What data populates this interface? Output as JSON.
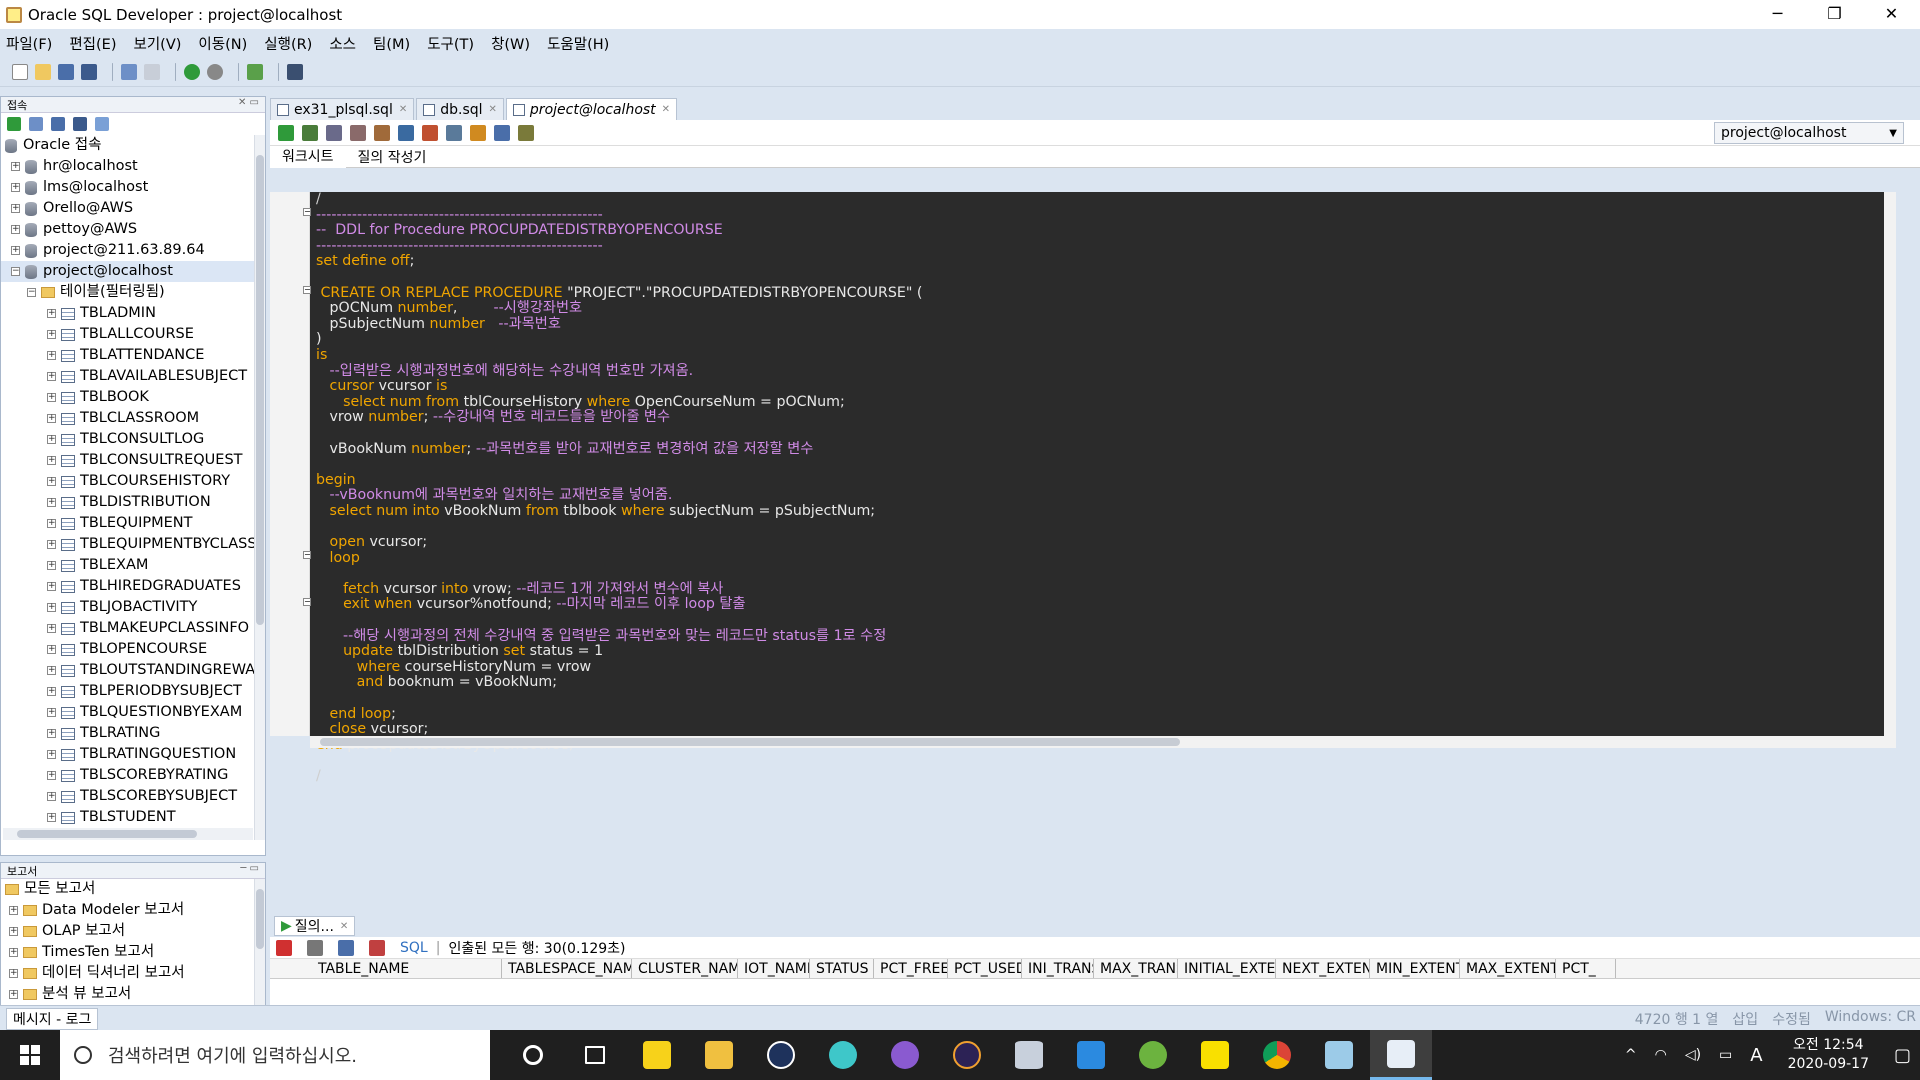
{
  "window": {
    "title": "Oracle SQL Developer : project@localhost",
    "min": "─",
    "max": "❐",
    "close": "✕"
  },
  "menu": [
    "파일(F)",
    "편집(E)",
    "보기(V)",
    "이동(N)",
    "실행(R)",
    "소스",
    "팀(M)",
    "도구(T)",
    "창(W)",
    "도움말(H)"
  ],
  "connections_panel": {
    "title": "접속",
    "root": "Oracle 접속",
    "items": [
      "hr@localhost",
      "lms@localhost",
      "Orello@AWS",
      "pettoy@AWS",
      "project@211.63.89.64",
      "project@localhost"
    ],
    "tables_folder": "테이블(필터링됨)",
    "tables": [
      "TBLADMIN",
      "TBLALLCOURSE",
      "TBLATTENDANCE",
      "TBLAVAILABLESUBJECT",
      "TBLBOOK",
      "TBLCLASSROOM",
      "TBLCONSULTLOG",
      "TBLCONSULTREQUEST",
      "TBLCOURSEHISTORY",
      "TBLDISTRIBUTION",
      "TBLEQUIPMENT",
      "TBLEQUIPMENTBYCLASS",
      "TBLEXAM",
      "TBLHIREDGRADUATES",
      "TBLJOBACTIVITY",
      "TBLMAKEUPCLASSINFO",
      "TBLOPENCOURSE",
      "TBLOUTSTANDINGREWA",
      "TBLPERIODBYSUBJECT",
      "TBLQUESTIONBYEXAM",
      "TBLRATING",
      "TBLRATINGQUESTION",
      "TBLSCOREBYRATING",
      "TBLSCOREBYSUBJECT",
      "TBLSTUDENT"
    ]
  },
  "reports_panel": {
    "title": "보고서",
    "items": [
      "모든 보고서",
      "Data Modeler 보고서",
      "OLAP 보고서",
      "TimesTen 보고서",
      "데이터 딕셔너리 보고서",
      "분석 뷰 보고서"
    ]
  },
  "editor": {
    "tabs": [
      {
        "label": "ex31_plsql.sql",
        "active": false
      },
      {
        "label": "db.sql",
        "active": false
      },
      {
        "label": "project@localhost",
        "active": true
      }
    ],
    "connection": "project@localhost",
    "subtabs": [
      "워크시트",
      "질의 작성기"
    ],
    "code_lines": [
      [
        [
          "dl",
          "/"
        ]
      ],
      [
        [
          "c",
          "--------------------------------------------------------"
        ]
      ],
      [
        [
          "c",
          "--  DDL for Procedure PROCUPDATEDISTRBYOPENCOURSE"
        ]
      ],
      [
        [
          "c",
          "--------------------------------------------------------"
        ]
      ],
      [
        [
          "k",
          "set define off"
        ],
        [
          "s",
          ";"
        ]
      ],
      [],
      [
        [
          "k",
          " CREATE OR REPLACE PROCEDURE "
        ],
        [
          "s",
          "\"PROJECT\".\"PROCUPDATEDISTRBYOPENCOURSE\" ("
        ]
      ],
      [
        [
          "s",
          "   pOCNum "
        ],
        [
          "k",
          "number"
        ],
        [
          "s",
          ",        "
        ],
        [
          "c",
          "--시행강좌번호"
        ]
      ],
      [
        [
          "s",
          "   pSubjectNum "
        ],
        [
          "k",
          "number"
        ],
        [
          "s",
          "   "
        ],
        [
          "c",
          "--과목번호"
        ]
      ],
      [
        [
          "s",
          ")"
        ]
      ],
      [
        [
          "k",
          "is"
        ]
      ],
      [
        [
          "c",
          "   --입력받은 시행과정번호에 해당하는 수강내역 번호만 가져옴."
        ]
      ],
      [
        [
          "s",
          "   "
        ],
        [
          "k",
          "cursor"
        ],
        [
          "s",
          " vcursor "
        ],
        [
          "k",
          "is"
        ]
      ],
      [
        [
          "s",
          "      "
        ],
        [
          "k",
          "select num from"
        ],
        [
          "s",
          " tblCourseHistory "
        ],
        [
          "k",
          "where"
        ],
        [
          "s",
          " OpenCourseNum = pOCNum;"
        ]
      ],
      [
        [
          "s",
          "   vrow "
        ],
        [
          "k",
          "number"
        ],
        [
          "s",
          "; "
        ],
        [
          "c",
          "--수강내역 번호 레코드들을 받아줄 변수"
        ]
      ],
      [],
      [
        [
          "s",
          "   vBookNum "
        ],
        [
          "k",
          "number"
        ],
        [
          "s",
          "; "
        ],
        [
          "c",
          "--과목번호를 받아 교재번호로 변경하여 값을 저장할 변수"
        ]
      ],
      [],
      [
        [
          "k",
          "begin"
        ]
      ],
      [
        [
          "c",
          "   --vBooknum에 과목번호와 일치하는 교재번호를 넣어줌."
        ]
      ],
      [
        [
          "s",
          "   "
        ],
        [
          "k",
          "select num into"
        ],
        [
          "s",
          " vBookNum "
        ],
        [
          "k",
          "from"
        ],
        [
          "s",
          " tblbook "
        ],
        [
          "k",
          "where"
        ],
        [
          "s",
          " subjectNum = pSubjectNum;"
        ]
      ],
      [],
      [
        [
          "s",
          "   "
        ],
        [
          "k",
          "open"
        ],
        [
          "s",
          " vcursor;"
        ]
      ],
      [
        [
          "s",
          "   "
        ],
        [
          "k",
          "loop"
        ]
      ],
      [],
      [
        [
          "s",
          "      "
        ],
        [
          "k",
          "fetch"
        ],
        [
          "s",
          " vcursor "
        ],
        [
          "k",
          "into"
        ],
        [
          "s",
          " vrow; "
        ],
        [
          "c",
          "--레코드 1개 가져와서 변수에 복사"
        ]
      ],
      [
        [
          "s",
          "      "
        ],
        [
          "k",
          "exit when"
        ],
        [
          "s",
          " vcursor%notfound; "
        ],
        [
          "c",
          "--마지막 레코드 이후 loop 탈출"
        ]
      ],
      [],
      [
        [
          "c",
          "      --해당 시행과정의 전체 수강내역 중 입력받은 과목번호와 맞는 레코드만 status를 1로 수정"
        ]
      ],
      [
        [
          "s",
          "      "
        ],
        [
          "k",
          "update"
        ],
        [
          "s",
          " tblDistribution "
        ],
        [
          "k",
          "set"
        ],
        [
          "s",
          " status = 1"
        ]
      ],
      [
        [
          "s",
          "         "
        ],
        [
          "k",
          "where"
        ],
        [
          "s",
          " courseHistoryNum = vrow"
        ]
      ],
      [
        [
          "s",
          "         "
        ],
        [
          "k",
          "and"
        ],
        [
          "s",
          " booknum = vBookNum;"
        ]
      ],
      [],
      [
        [
          "s",
          "   "
        ],
        [
          "k",
          "end loop"
        ],
        [
          "s",
          ";"
        ]
      ],
      [
        [
          "s",
          "   "
        ],
        [
          "k",
          "close"
        ],
        [
          "s",
          " vcursor;"
        ]
      ],
      [
        [
          "k",
          "end"
        ],
        [
          "s",
          " procUpdateDistrByOpenCourse;"
        ]
      ],
      [],
      [
        [
          "dl",
          "/"
        ]
      ]
    ]
  },
  "results": {
    "tab_label": "질의...",
    "sql_label": "SQL",
    "status_text": "인출된 모든 행: 30(0.129초)",
    "columns": [
      "TABLE_NAME",
      "TABLESPACE_NAME",
      "CLUSTER_NAME",
      "IOT_NAME",
      "STATUS",
      "PCT_FREE",
      "PCT_USED",
      "INI_TRANS",
      "MAX_TRANS",
      "INITIAL_EXTENT",
      "NEXT_EXTENT",
      "MIN_EXTENTS",
      "MAX_EXTENTS",
      "PCT_"
    ]
  },
  "statusbar": {
    "message_tab": "메시지 - 로그",
    "position": "4720 행 1 열",
    "mode": "삽입",
    "state": "수정됨",
    "encoding": "Windows: CR"
  },
  "taskbar": {
    "search_placeholder": "검색하려면 여기에 입력하십시오.",
    "time": "오전 12:54",
    "date": "2020-09-17",
    "ime": "A"
  },
  "colors": {
    "keyword": "#f0a500",
    "comment": "#d08be6",
    "editor_bg": "#2b2b2b",
    "chrome": "#dbe5f1"
  }
}
